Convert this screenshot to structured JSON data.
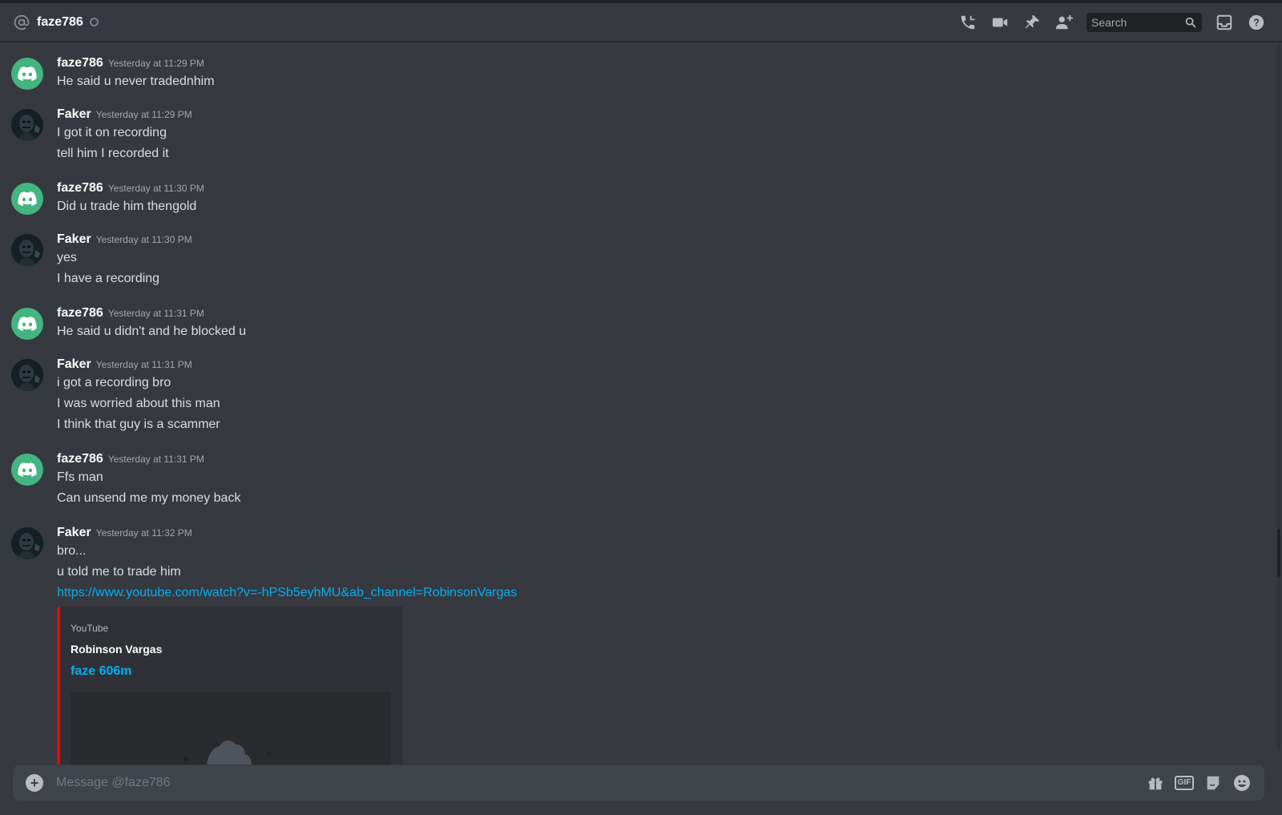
{
  "header": {
    "channel_name": "faze786",
    "search_placeholder": "Search"
  },
  "messages": [
    {
      "author": "faze786",
      "avatar": "discord-logo",
      "timestamp": "Yesterday at 11:29 PM",
      "lines": [
        "He said u never tradednhim"
      ]
    },
    {
      "author": "Faker",
      "avatar": "faker-avatar",
      "timestamp": "Yesterday at 11:29 PM",
      "lines": [
        "I got it on recording",
        "tell him I recorded it"
      ]
    },
    {
      "author": "faze786",
      "avatar": "discord-logo",
      "timestamp": "Yesterday at 11:30 PM",
      "lines": [
        "Did u trade him thengold"
      ]
    },
    {
      "author": "Faker",
      "avatar": "faker-avatar",
      "timestamp": "Yesterday at 11:30 PM",
      "lines": [
        "yes",
        "I have a recording"
      ]
    },
    {
      "author": "faze786",
      "avatar": "discord-logo",
      "timestamp": "Yesterday at 11:31 PM",
      "lines": [
        "He said u didn't and he blocked u"
      ]
    },
    {
      "author": "Faker",
      "avatar": "faker-avatar",
      "timestamp": "Yesterday at 11:31 PM",
      "lines": [
        "i got a recording bro",
        "I was worried about this man",
        "I think that guy is a scammer"
      ]
    },
    {
      "author": "faze786",
      "avatar": "discord-logo",
      "timestamp": "Yesterday at 11:31 PM",
      "lines": [
        "Ffs man",
        "Can unsend me my money back"
      ]
    },
    {
      "author": "Faker",
      "avatar": "faker-avatar",
      "timestamp": "Yesterday at 11:32 PM",
      "lines": [
        "bro...",
        "u told me to trade him"
      ],
      "link": "https://www.youtube.com/watch?v=-hPSb5eyhMU&ab_channel=RobinsonVargas"
    }
  ],
  "embed": {
    "provider": "YouTube",
    "author": "Robinson Vargas",
    "title": "faze 606m",
    "accent_color": "#ff0000"
  },
  "composer": {
    "placeholder": "Message @faze786",
    "gif_label": "GIF"
  },
  "colors": {
    "background": "#36393f",
    "link": "#00b0f4",
    "discord_green": "#43b581"
  },
  "icons": [
    "at-icon",
    "call-icon",
    "video-icon",
    "pin-icon",
    "add-friend-icon",
    "search-icon",
    "inbox-icon",
    "help-icon",
    "plus-icon",
    "gift-icon",
    "gif-icon",
    "sticker-icon",
    "emoji-icon"
  ]
}
